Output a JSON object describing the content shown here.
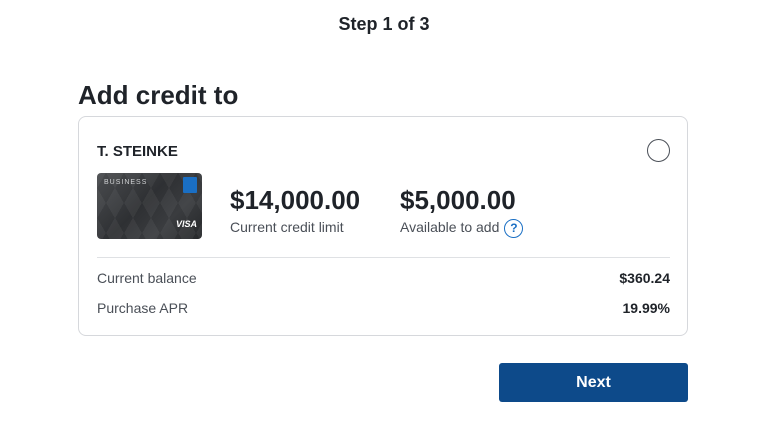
{
  "header": {
    "step": "Step 1 of 3"
  },
  "page": {
    "title": "Add credit to"
  },
  "account": {
    "holder": "T. STEINKE",
    "card_image": {
      "top_text": "BUSINESS",
      "network": "VISA"
    },
    "credit_limit": {
      "value": "$14,000.00",
      "label": "Current credit limit"
    },
    "available": {
      "value": "$5,000.00",
      "label": "Available to add",
      "help_glyph": "?"
    },
    "details": [
      {
        "label": "Current balance",
        "value": "$360.24"
      },
      {
        "label": "Purchase APR",
        "value": "19.99%"
      }
    ]
  },
  "actions": {
    "next_label": "Next"
  },
  "colors": {
    "primary": "#0d4a8a",
    "link": "#1a6fc4",
    "border": "#d6d8dc"
  }
}
